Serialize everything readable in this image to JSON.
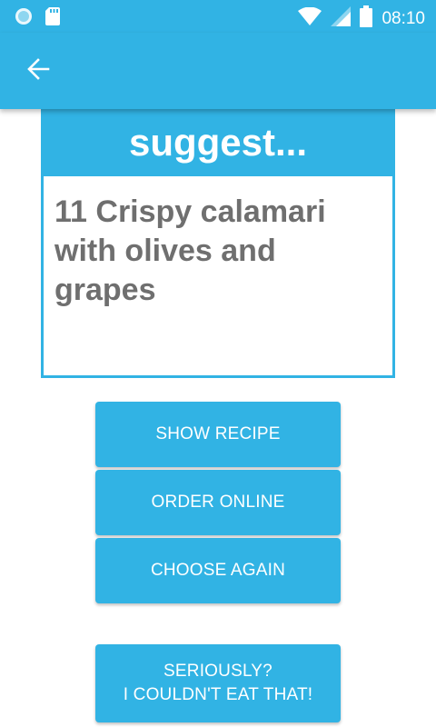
{
  "status_bar": {
    "time": "08:10",
    "icons": [
      "circle-notification-icon",
      "sd-card-icon",
      "wifi-icon",
      "cell-signal-icon",
      "battery-icon"
    ]
  },
  "app_bar": {
    "back_icon": "arrow-left-icon"
  },
  "suggestion": {
    "header": "suggest...",
    "text": "11 Crispy calamari with olives and grapes"
  },
  "buttons": {
    "show_recipe": "SHOW RECIPE",
    "order_online": "ORDER ONLINE",
    "choose_again": "CHOOSE AGAIN",
    "seriously": "SERIOUSLY?\nI COULDN'T EAT THAT!"
  },
  "colors": {
    "accent": "#31b3e4",
    "text_gray": "#6f6f6f",
    "white": "#ffffff"
  }
}
